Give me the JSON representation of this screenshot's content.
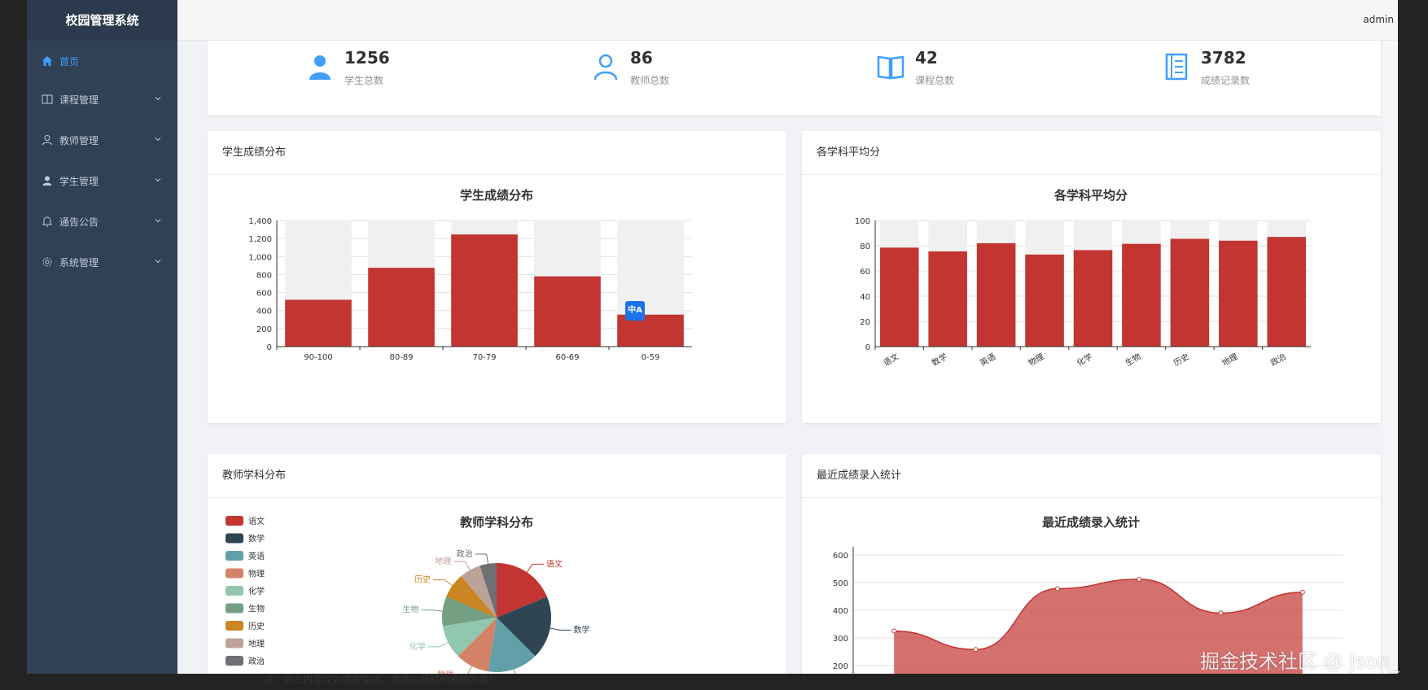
{
  "app": {
    "title": "校园管理系统",
    "user": "admin"
  },
  "sidebar": {
    "items": [
      {
        "label": "首页",
        "icon": "home-icon",
        "active": true
      },
      {
        "label": "课程管理",
        "icon": "book-icon"
      },
      {
        "label": "教师管理",
        "icon": "user-outline-icon"
      },
      {
        "label": "学生管理",
        "icon": "user-solid-icon"
      },
      {
        "label": "通告公告",
        "icon": "bell-icon"
      },
      {
        "label": "系统管理",
        "icon": "gear-icon"
      }
    ]
  },
  "stats": [
    {
      "value": "1256",
      "label": "学生总数",
      "icon": "user-solid-icon"
    },
    {
      "value": "86",
      "label": "教师总数",
      "icon": "user-outline-icon"
    },
    {
      "value": "42",
      "label": "课程总数",
      "icon": "open-book-icon"
    },
    {
      "value": "3782",
      "label": "成绩记录数",
      "icon": "notebook-icon"
    }
  ],
  "cards": {
    "score_dist": "学生成绩分布",
    "subject_avg": "各学科平均分",
    "teacher_dist": "教师学科分布",
    "recent_entry": "最近成绩录入统计"
  },
  "colors": {
    "accent": "#409eff",
    "bar": "#c23531",
    "sidebar": "#304156",
    "pie": [
      "#c23531",
      "#2f4554",
      "#61a0a8",
      "#d48265",
      "#91c7ae",
      "#749f83",
      "#ca8622",
      "#bda29a",
      "#6e7074"
    ]
  },
  "chart_data": [
    {
      "type": "bar",
      "title": "学生成绩分布",
      "categories": [
        "90-100",
        "80-89",
        "70-79",
        "60-69",
        "0-59"
      ],
      "values": [
        520,
        875,
        1245,
        780,
        355
      ],
      "ylim": [
        0,
        1400
      ],
      "yticks": [
        "0",
        "200",
        "400",
        "600",
        "800",
        "1,000",
        "1,200",
        "1,400"
      ],
      "background_bars": true
    },
    {
      "type": "bar",
      "title": "各学科平均分",
      "categories": [
        "语文",
        "数学",
        "英语",
        "物理",
        "化学",
        "生物",
        "历史",
        "地理",
        "政治"
      ],
      "values": [
        78.5,
        75.5,
        82,
        73,
        76.5,
        81.5,
        85.5,
        84,
        87
      ],
      "ylim": [
        0,
        100
      ],
      "yticks": [
        "0",
        "20",
        "40",
        "60",
        "80",
        "100"
      ],
      "background_bars": true
    },
    {
      "type": "pie",
      "title": "教师学科分布",
      "legend": [
        "语文",
        "数学",
        "英语",
        "物理",
        "化学",
        "生物",
        "历史",
        "地理",
        "政治"
      ],
      "values": [
        15,
        15,
        12,
        8,
        8,
        7,
        6,
        5,
        4
      ],
      "legend_position": "left"
    },
    {
      "type": "area",
      "title": "最近成绩录入统计",
      "values": [
        325,
        258,
        478,
        512,
        390,
        465
      ],
      "ylim": [
        100,
        600
      ],
      "yticks": [
        "200",
        "300",
        "400",
        "500",
        "600"
      ]
    }
  ],
  "footnote": "注：以上内容仅为简要描述，具体以获取的资料为准！",
  "watermark": "掘金技术社区 @ Json_"
}
